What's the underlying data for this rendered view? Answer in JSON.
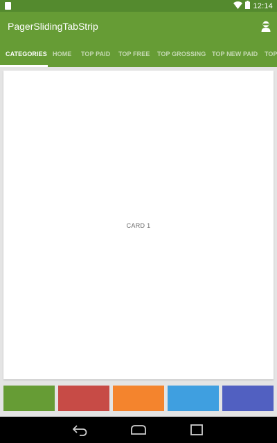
{
  "status_bar": {
    "time": "12:14",
    "icons": [
      "sim-icon",
      "wifi-icon",
      "battery-icon"
    ]
  },
  "toolbar": {
    "title": "PagerSlidingTabStrip",
    "action_icon": "contact-icon"
  },
  "tabs": [
    {
      "label": "CATEGORIES",
      "active": true
    },
    {
      "label": "HOME",
      "active": false
    },
    {
      "label": "TOP PAID",
      "active": false
    },
    {
      "label": "TOP FREE",
      "active": false
    },
    {
      "label": "TOP GROSSING",
      "active": false
    },
    {
      "label": "TOP NEW PAID",
      "active": false
    },
    {
      "label": "TOP",
      "active": false
    }
  ],
  "card": {
    "label": "CARD 1"
  },
  "color_swatches": [
    {
      "name": "green",
      "color": "#669c35"
    },
    {
      "name": "red",
      "color": "#c74b46"
    },
    {
      "name": "orange",
      "color": "#f4842d"
    },
    {
      "name": "blue",
      "color": "#3f9fe0"
    },
    {
      "name": "indigo",
      "color": "#5160c1"
    }
  ],
  "colors": {
    "primary": "#669c35",
    "status_bar": "#548a2e",
    "background": "#e4e4e4"
  },
  "nav_bar": {
    "buttons": [
      "back-icon",
      "home-icon",
      "recents-icon"
    ]
  }
}
